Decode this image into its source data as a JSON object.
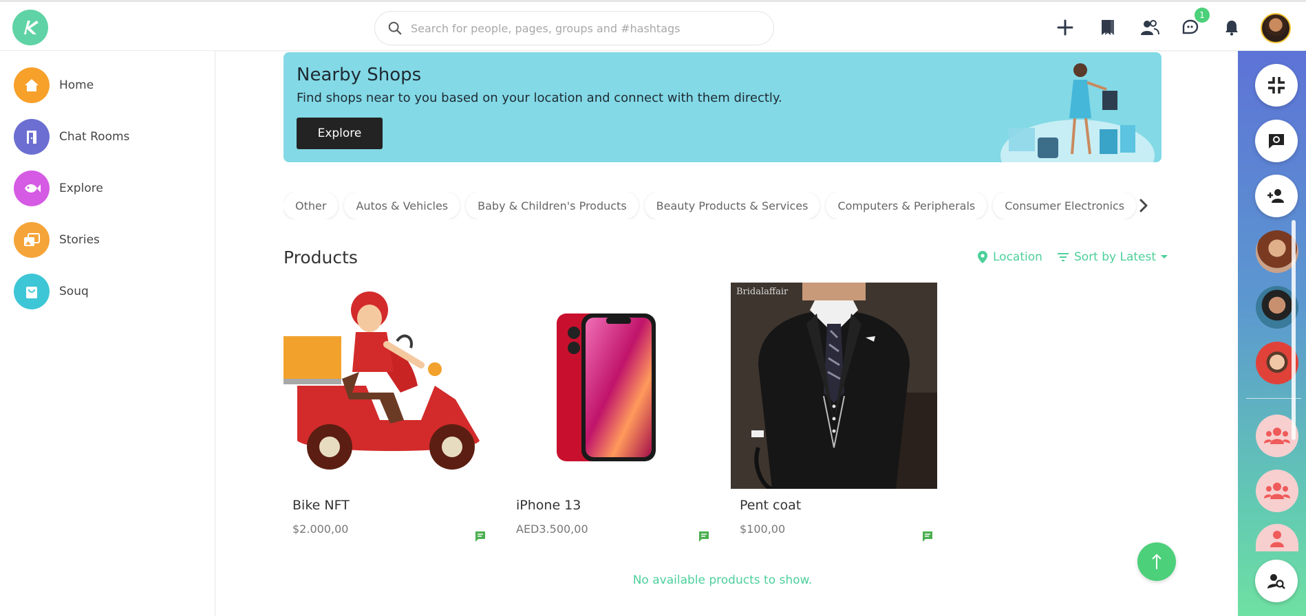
{
  "header": {
    "search": {
      "placeholder": "Search for people, pages, groups and #hashtags",
      "value": ""
    },
    "icons": [
      "plus-icon",
      "bookmark-icon",
      "friends-icon",
      "messages-icon",
      "bell-icon"
    ],
    "messages_badge": "1"
  },
  "sidebar": {
    "items": [
      {
        "label": "Home",
        "icon": "home-icon",
        "color": "#f7a02a"
      },
      {
        "label": "Chat Rooms",
        "icon": "door-icon",
        "color": "#6c6fd1"
      },
      {
        "label": "Explore",
        "icon": "fish-icon",
        "color": "#d55ae4"
      },
      {
        "label": "Stories",
        "icon": "gallery-icon",
        "color": "#f5a43a"
      },
      {
        "label": "Souq",
        "icon": "bag-icon",
        "color": "#3dc6d6"
      }
    ]
  },
  "banner": {
    "title": "Nearby Shops",
    "subtitle": "Find shops near to you based on your location and connect with them directly.",
    "button": "Explore"
  },
  "categories": [
    "Other",
    "Autos & Vehicles",
    "Baby & Children's Products",
    "Beauty Products & Services",
    "Computers & Peripherals",
    "Consumer Electronics"
  ],
  "products_section": {
    "title": "Products",
    "location_label": "Location",
    "sort_label": "Sort by Latest",
    "empty_message": "No available products to show."
  },
  "products": [
    {
      "name": "Bike NFT",
      "price": "$2.000,00",
      "image": "scooter-delivery-image"
    },
    {
      "name": "iPhone 13",
      "price": "AED3.500,00",
      "image": "iphone-image"
    },
    {
      "name": "Pent coat",
      "price": "$100,00",
      "image": "suit-image",
      "watermark": "Bridalaffair"
    }
  ],
  "colors": {
    "accent": "#4cd07a",
    "banner": "#83d9e6"
  }
}
